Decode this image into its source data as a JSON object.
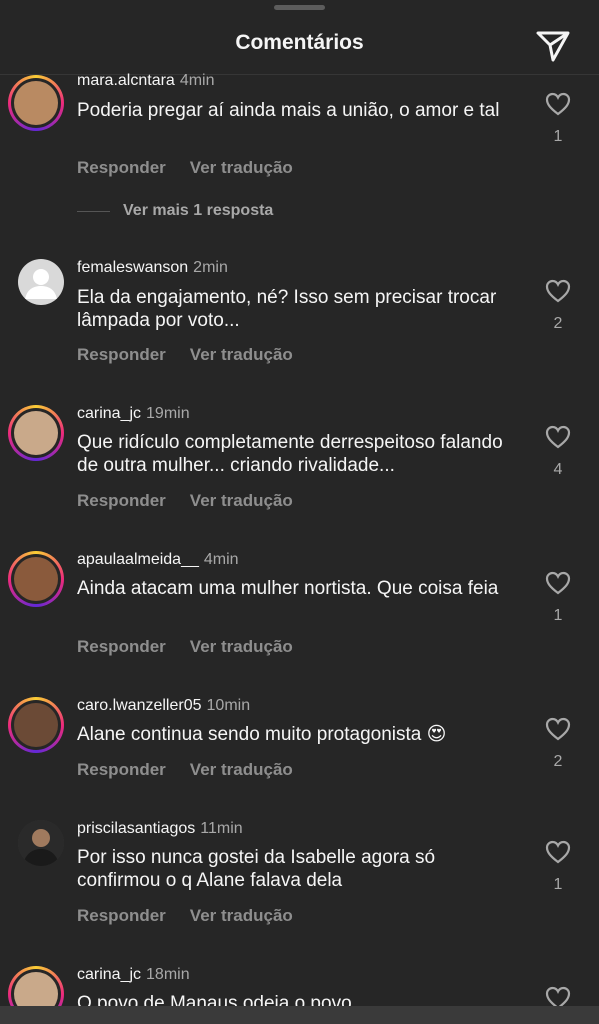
{
  "header": {
    "title": "Comentários",
    "share_icon": "paper-plane-icon"
  },
  "comments": [
    {
      "username": "mara.alcntara",
      "time": "4min",
      "text": "Poderia pregar aí ainda mais a união, o amor e tal",
      "likes": "1",
      "reply": "Responder",
      "translate": "Ver tradução",
      "more_replies": "Ver mais 1 resposta",
      "avatar_color": "#b98a62",
      "story_ring": true
    },
    {
      "username": "femaleswanson",
      "time": "2min",
      "text": "Ela da engajamento, né? Isso sem precisar trocar lâmpada por voto...",
      "likes": "2",
      "reply": "Responder",
      "translate": "Ver tradução",
      "avatar_color": "#d9d9d9",
      "story_ring": false
    },
    {
      "username": "carina_jc",
      "time": "19min",
      "text": "Que ridículo completamente derrespeitoso falando de outra mulher... criando rivalidade...",
      "likes": "4",
      "reply": "Responder",
      "translate": "Ver tradução",
      "avatar_color": "#c9a98a",
      "story_ring": true
    },
    {
      "username": "apaulaalmeida__",
      "time": "4min",
      "text": "Ainda atacam uma mulher nortista. Que coisa feia",
      "likes": "1",
      "reply": "Responder",
      "translate": "Ver tradução",
      "avatar_color": "#8a5a3c",
      "story_ring": true
    },
    {
      "username": "caro.lwanzeller05",
      "time": "10min",
      "text": "Alane continua sendo muito protagonista 😍",
      "likes": "2",
      "reply": "Responder",
      "translate": "Ver tradução",
      "avatar_color": "#6b4a36",
      "story_ring": true
    },
    {
      "username": "priscilasantiagos",
      "time": "11min",
      "text": "Por isso nunca gostei da Isabelle agora só confirmou o q Alane falava dela",
      "likes": "1",
      "reply": "Responder",
      "translate": "Ver tradução",
      "avatar_color": "#3c3c3c",
      "story_ring": false
    },
    {
      "username": "carina_jc",
      "time": "18min",
      "text": "O povo de Manaus odeia o povo",
      "likes": "",
      "avatar_color": "#c9a98a",
      "story_ring": true
    }
  ]
}
